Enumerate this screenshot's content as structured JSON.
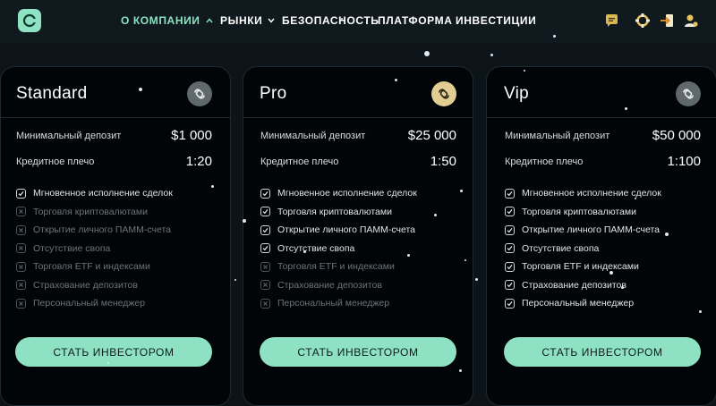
{
  "nav": {
    "items": [
      {
        "label": "О КОМПАНИИ",
        "dropdown": true,
        "active": true
      },
      {
        "label": "РЫНКИ",
        "dropdown": true,
        "active": false
      },
      {
        "label": "БЕЗОПАСНОСТЬ",
        "dropdown": false,
        "active": false
      },
      {
        "label": "ПЛАТФОРМА",
        "dropdown": false,
        "active": false
      },
      {
        "label": "ИНВЕСТИЦИИ",
        "dropdown": false,
        "active": false
      }
    ],
    "icons": [
      "chat-icon",
      "support-icon",
      "login-icon",
      "user-icon"
    ]
  },
  "labels": {
    "min_deposit": "Минимальный депозит",
    "leverage": "Кредитное плечо"
  },
  "features": [
    "Мгновенное исполнение сделок",
    "Торговля криптовалютами",
    "Открытие личного ПАММ-счета",
    "Отсутствие свопа",
    "Торговля ETF и индексами",
    "Страхование депозитов",
    "Персональный менеджер"
  ],
  "plans": [
    {
      "name": "Standard",
      "deposit": "$1 000",
      "leverage": "1:20",
      "badge": "gray",
      "enabled": [
        true,
        false,
        false,
        false,
        false,
        false,
        false
      ],
      "button": "СТАТЬ ИНВЕСТОРОМ"
    },
    {
      "name": "Pro",
      "deposit": "$25 000",
      "leverage": "1:50",
      "badge": "gold",
      "enabled": [
        true,
        true,
        true,
        true,
        false,
        false,
        false
      ],
      "button": "СТАТЬ ИНВЕСТОРОМ"
    },
    {
      "name": "Vip",
      "deposit": "$50 000",
      "leverage": "1:100",
      "badge": "gray",
      "enabled": [
        true,
        true,
        true,
        true,
        true,
        true,
        true
      ],
      "button": "СТАТЬ ИНВЕСТОРОМ"
    }
  ],
  "colors": {
    "accent": "#8ee2c3",
    "gold": "#e2cd92",
    "background": "#0c1419",
    "card": "#020507"
  }
}
